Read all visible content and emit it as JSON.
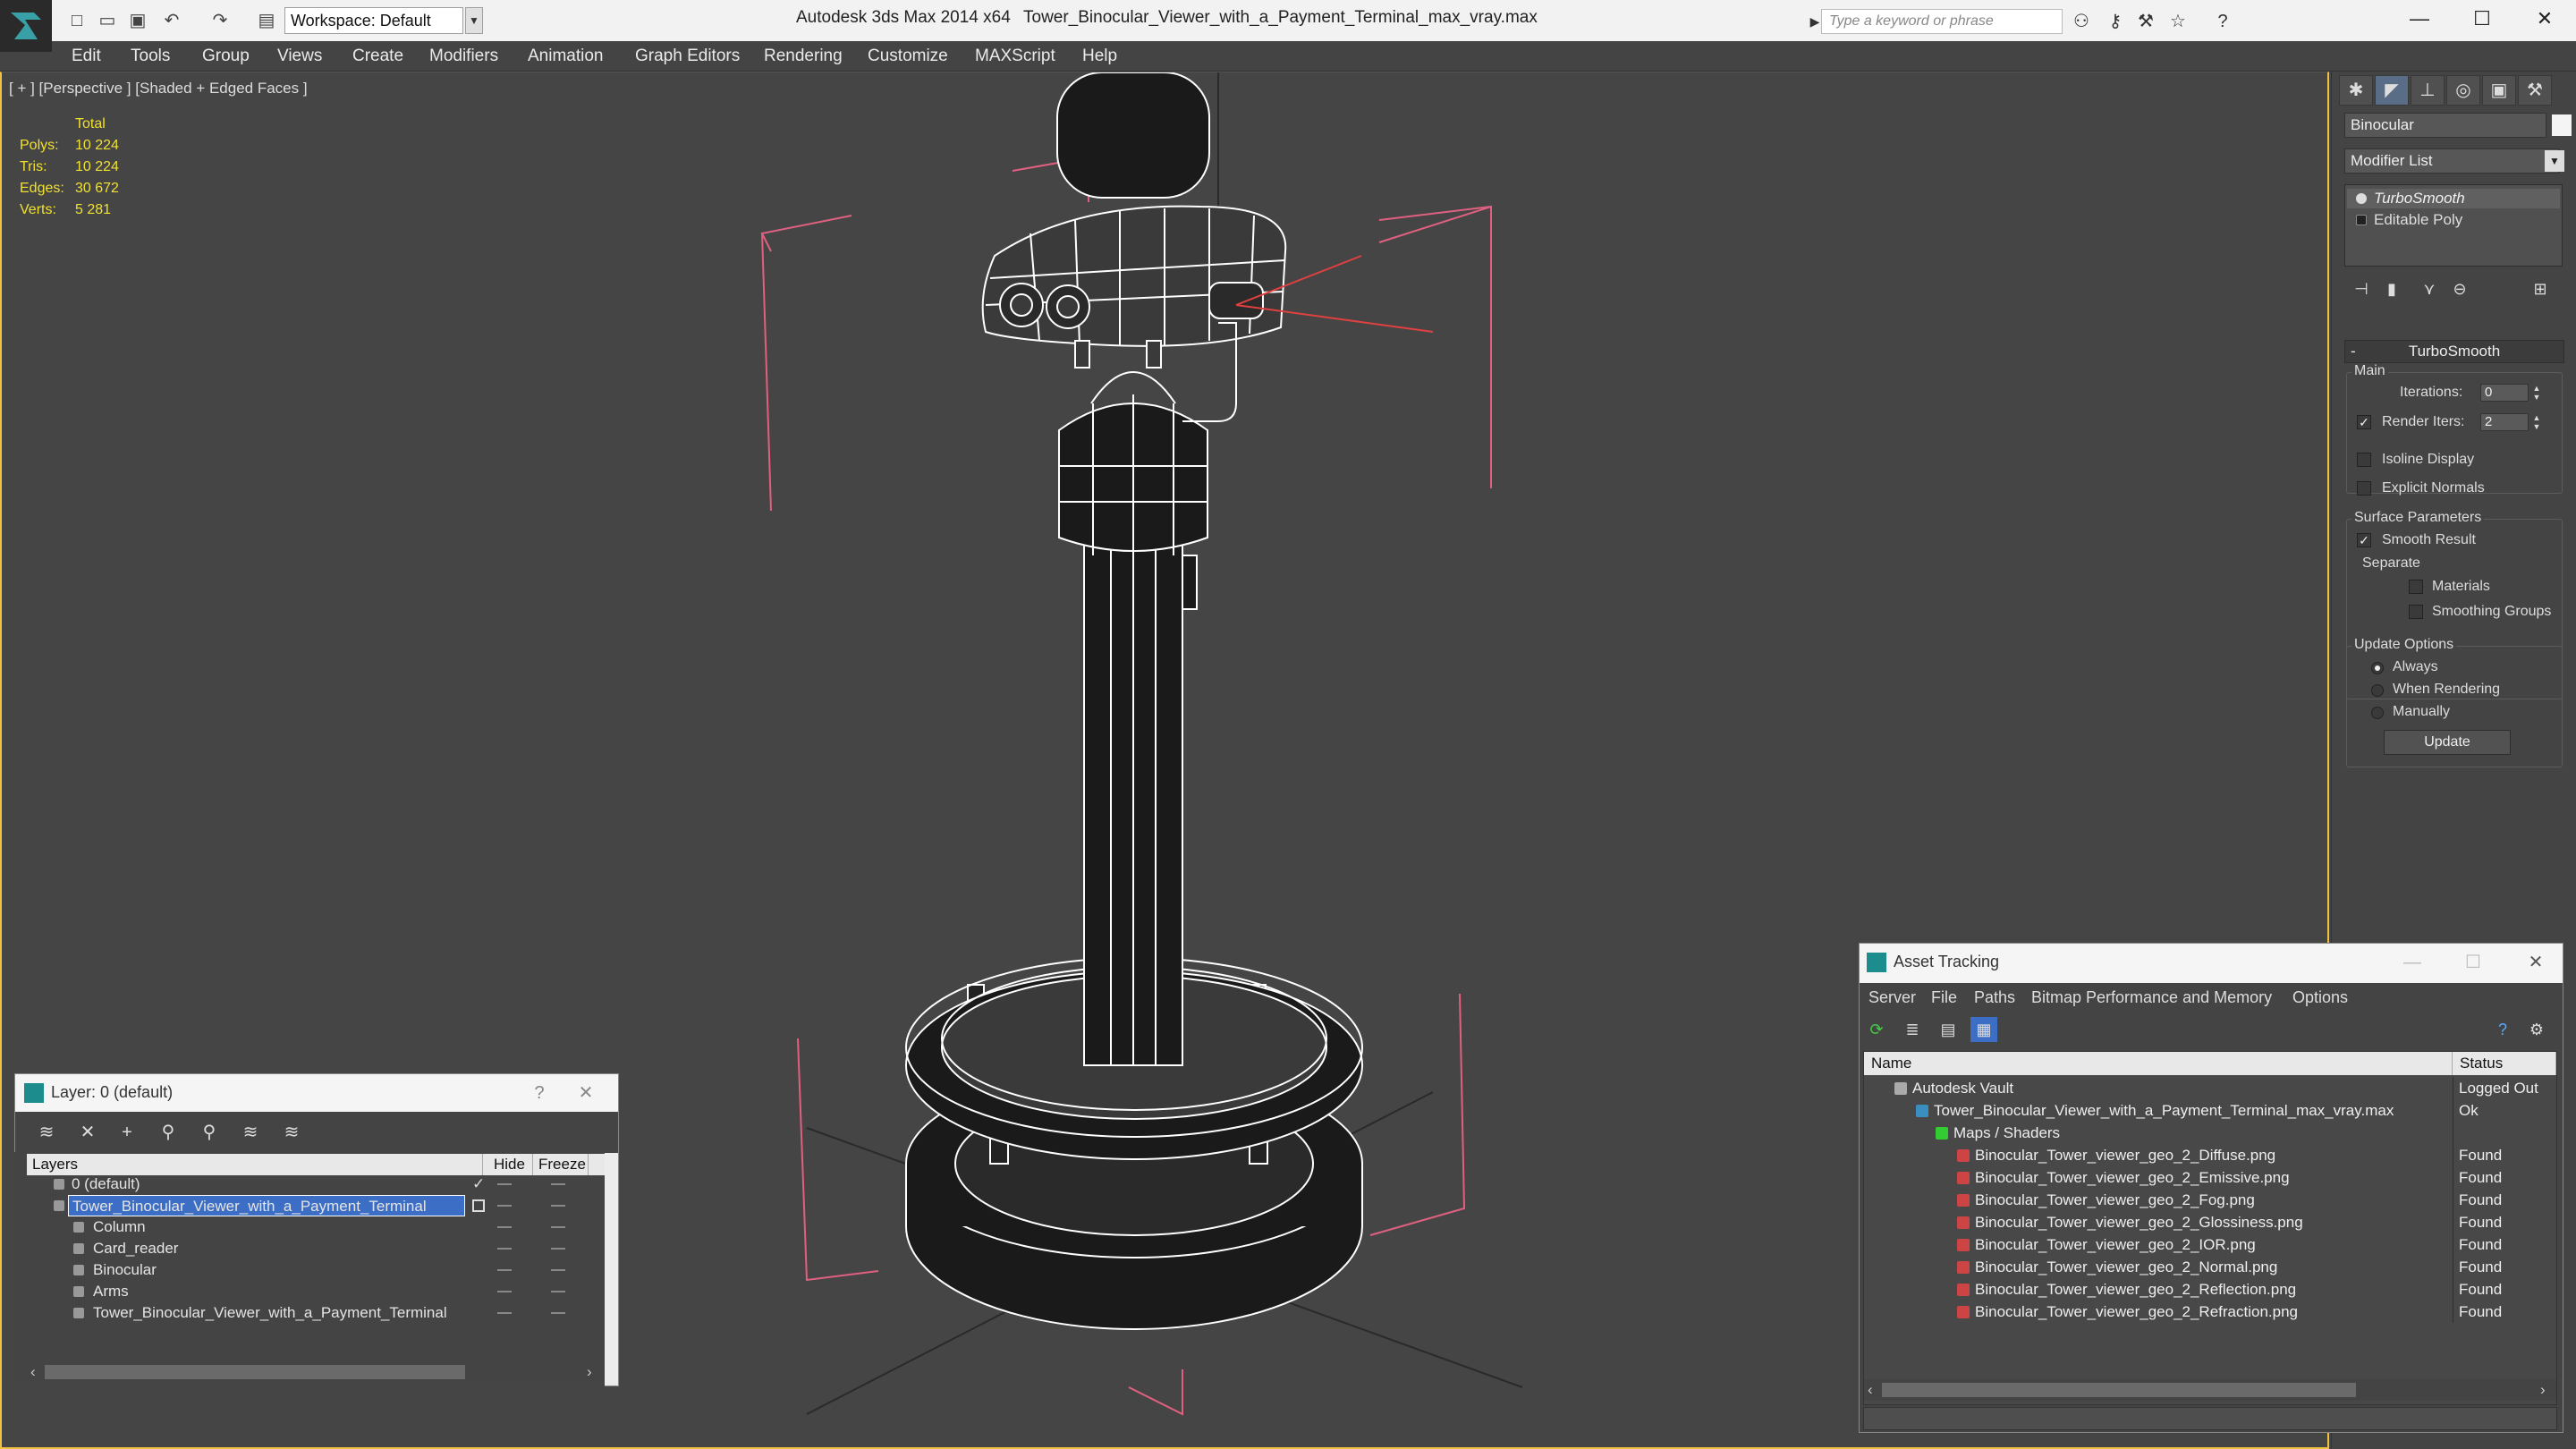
{
  "titlebar": {
    "workspace_label": "Workspace: Default",
    "app_title": "Autodesk 3ds Max  2014 x64",
    "file_title": "Tower_Binocular_Viewer_with_a_Payment_Terminal_max_vray.max",
    "search_placeholder": "Type a keyword or phrase"
  },
  "menu": [
    "Edit",
    "Tools",
    "Group",
    "Views",
    "Create",
    "Modifiers",
    "Animation",
    "Graph Editors",
    "Rendering",
    "Customize",
    "MAXScript",
    "Help"
  ],
  "viewport": {
    "label": "[ + ] [Perspective ] [Shaded + Edged Faces ]",
    "stats_header": "Total",
    "stats": [
      {
        "label": "Polys:",
        "value": "10 224"
      },
      {
        "label": "Tris:",
        "value": "10 224"
      },
      {
        "label": "Edges:",
        "value": "30 672"
      },
      {
        "label": "Verts:",
        "value": "5 281"
      }
    ]
  },
  "command_panel": {
    "object_name": "Binocular",
    "modifier_list": "Modifier List",
    "stack": [
      {
        "label": "TurboSmooth",
        "selected": true
      },
      {
        "label": "Editable Poly",
        "selected": false
      }
    ],
    "rollout_title": "TurboSmooth",
    "main_group": "Main",
    "iterations_label": "Iterations:",
    "iterations_value": "0",
    "render_iters_label": "Render Iters:",
    "render_iters_value": "2",
    "isoline_label": "Isoline Display",
    "explicit_normals_label": "Explicit Normals",
    "surface_group": "Surface Parameters",
    "smooth_result_label": "Smooth Result",
    "separate_label": "Separate",
    "materials_label": "Materials",
    "smoothing_groups_label": "Smoothing Groups",
    "update_group": "Update Options",
    "always_label": "Always",
    "when_rendering_label": "When Rendering",
    "manually_label": "Manually",
    "update_button": "Update"
  },
  "layer_dialog": {
    "title": "Layer: 0 (default)",
    "columns": [
      "Layers",
      "Hide",
      "Freeze"
    ],
    "rows": [
      {
        "name": "0 (default)",
        "indent": 1
      },
      {
        "name": "Tower_Binocular_Viewer_with_a_Payment_Terminal",
        "indent": 1
      },
      {
        "name": "Column",
        "indent": 2
      },
      {
        "name": "Card_reader",
        "indent": 2
      },
      {
        "name": "Binocular",
        "indent": 2
      },
      {
        "name": "Arms",
        "indent": 2
      },
      {
        "name": "Tower_Binocular_Viewer_with_a_Payment_Terminal",
        "indent": 2
      }
    ]
  },
  "asset_dialog": {
    "title": "Asset Tracking",
    "menu": [
      "Server",
      "File",
      "Paths",
      "Bitmap Performance and Memory",
      "Options"
    ],
    "columns": [
      "Name",
      "Status"
    ],
    "rows": [
      {
        "name": "Autodesk Vault",
        "status": "Logged Out",
        "indent": 1
      },
      {
        "name": "Tower_Binocular_Viewer_with_a_Payment_Terminal_max_vray.max",
        "status": "Ok",
        "indent": 2
      },
      {
        "name": "Maps / Shaders",
        "status": "",
        "indent": 3
      },
      {
        "name": "Binocular_Tower_viewer_geo_2_Diffuse.png",
        "status": "Found",
        "indent": 4
      },
      {
        "name": "Binocular_Tower_viewer_geo_2_Emissive.png",
        "status": "Found",
        "indent": 4
      },
      {
        "name": "Binocular_Tower_viewer_geo_2_Fog.png",
        "status": "Found",
        "indent": 4
      },
      {
        "name": "Binocular_Tower_viewer_geo_2_Glossiness.png",
        "status": "Found",
        "indent": 4
      },
      {
        "name": "Binocular_Tower_viewer_geo_2_IOR.png",
        "status": "Found",
        "indent": 4
      },
      {
        "name": "Binocular_Tower_viewer_geo_2_Normal.png",
        "status": "Found",
        "indent": 4
      },
      {
        "name": "Binocular_Tower_viewer_geo_2_Reflection.png",
        "status": "Found",
        "indent": 4
      },
      {
        "name": "Binocular_Tower_viewer_geo_2_Refraction.png",
        "status": "Found",
        "indent": 4
      }
    ]
  },
  "colors": {
    "viewport_border": "#f0c040",
    "stats_text": "#f0e030",
    "selection": "#3d6ec6",
    "bbox_lines": "#e06080"
  }
}
